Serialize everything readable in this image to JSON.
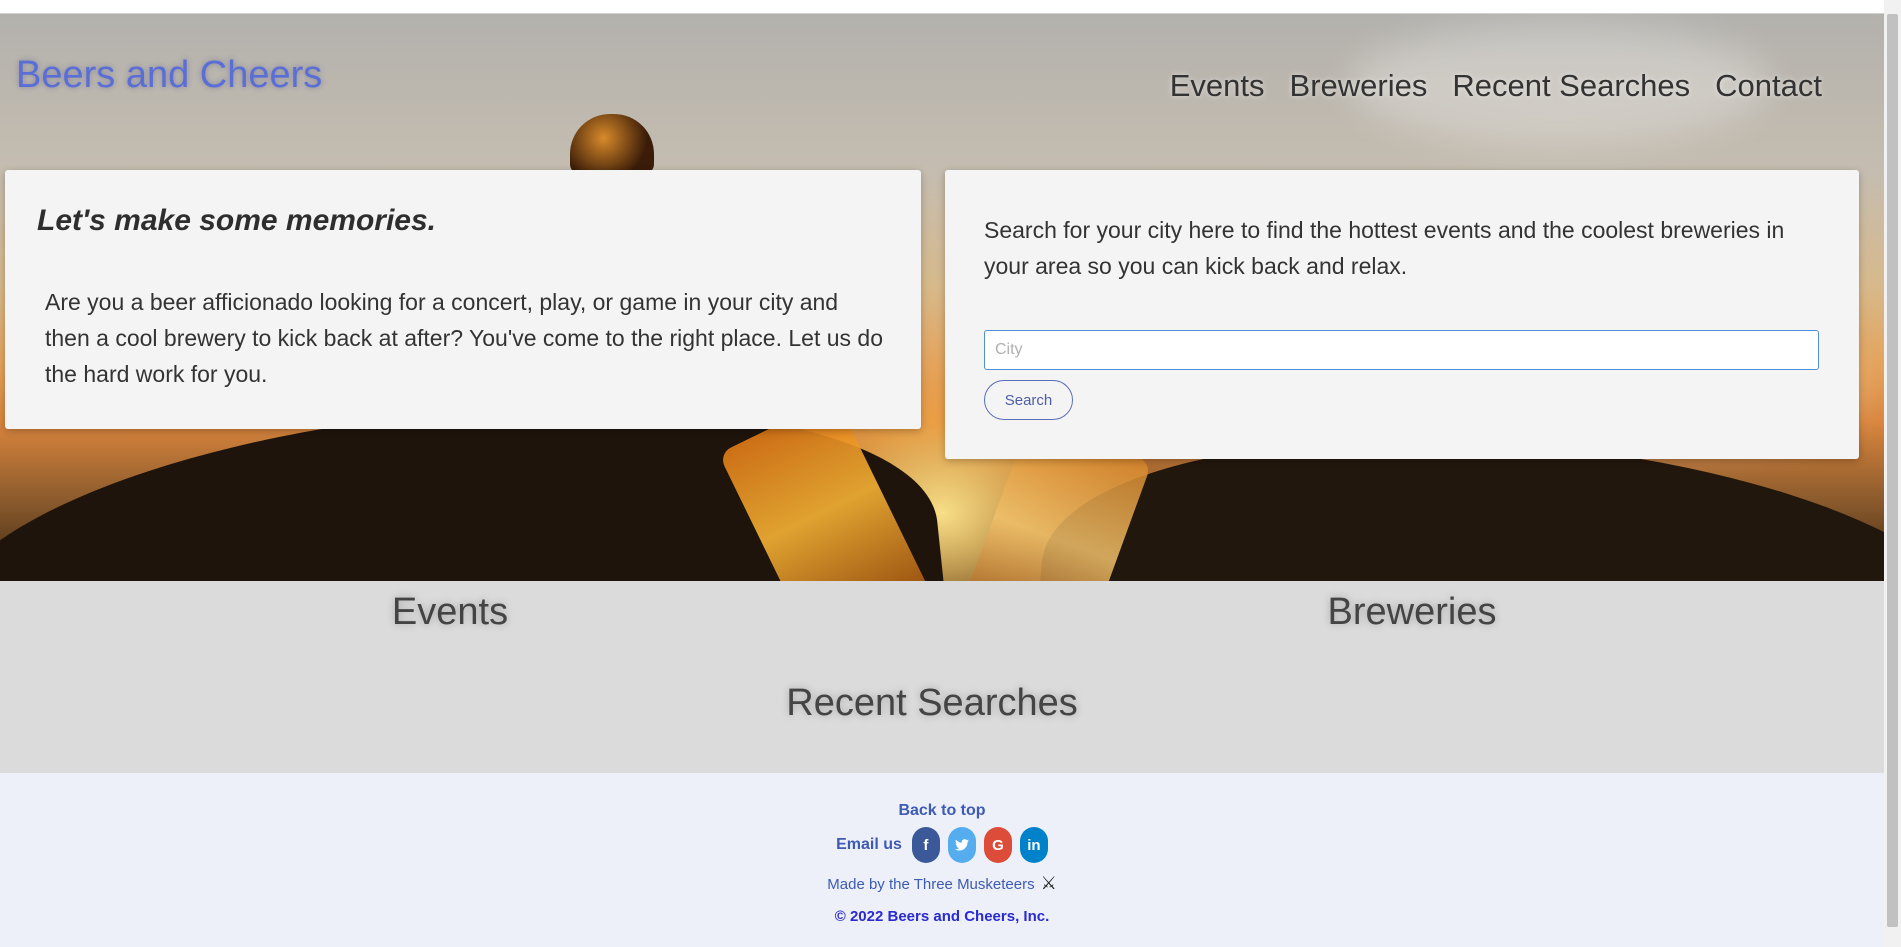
{
  "header": {
    "brand": "Beers and Cheers",
    "nav": [
      "Events",
      "Breweries",
      "Recent Searches",
      "Contact"
    ]
  },
  "intro_card": {
    "heading": "Let's make some memories.",
    "body": "Are you a beer afficionado looking for a concert, play, or game in your city and then a cool brewery to kick back at after? You've come to the right place. Let us do the hard work for you."
  },
  "search_card": {
    "description": "Search for your city here to find the hottest events and the coolest breweries in your area so you can kick back and relax.",
    "input_placeholder": "City",
    "input_value": "",
    "button_label": "Search"
  },
  "results": {
    "events_heading": "Events",
    "breweries_heading": "Breweries",
    "recent_heading": "Recent Searches"
  },
  "footer": {
    "back_to_top": "Back to top",
    "email_label": "Email us",
    "social": [
      {
        "name": "facebook",
        "glyph": "f",
        "color": "#3b5998"
      },
      {
        "name": "twitter",
        "glyph": "t",
        "color": "#55acee"
      },
      {
        "name": "google",
        "glyph": "G",
        "color": "#dd4b39"
      },
      {
        "name": "linkedin",
        "glyph": "in",
        "color": "#0082ca"
      }
    ],
    "made_by": "Made by the Three Musketeers",
    "made_by_icon": "crossed-swords-icon",
    "copyright": "© 2022 Beers and Cheers, Inc."
  },
  "colors": {
    "brand": "#5a6fd6",
    "link": "#3d5bb4",
    "results_bg": "#dbdbdb",
    "footer_bg": "#edf0f8"
  }
}
